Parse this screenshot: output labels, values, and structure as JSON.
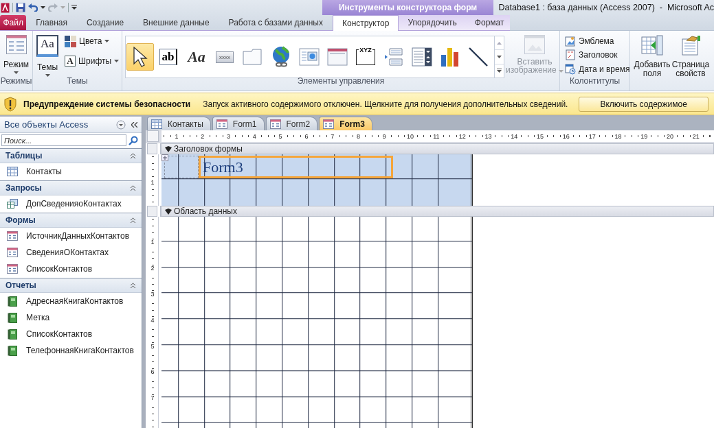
{
  "window": {
    "title": "Database1 : база данных (Access 2007)  -  Microsoft Ac"
  },
  "contextual_group": {
    "label": "Инструменты конструктора форм"
  },
  "ribbon_tabs": [
    {
      "label": "Файл",
      "kind": "file",
      "selected": false
    },
    {
      "label": "Главная",
      "kind": "main",
      "selected": false
    },
    {
      "label": "Создание",
      "kind": "main",
      "selected": false
    },
    {
      "label": "Внешние данные",
      "kind": "main",
      "selected": false
    },
    {
      "label": "Работа с базами данных",
      "kind": "main",
      "selected": false
    },
    {
      "label": "Конструктор",
      "kind": "contextual",
      "selected": true
    },
    {
      "label": "Упорядочить",
      "kind": "contextual",
      "selected": false
    },
    {
      "label": "Формат",
      "kind": "contextual",
      "selected": false
    }
  ],
  "ribbon": {
    "views": {
      "label": "Режимы",
      "button": "Режим"
    },
    "themes": {
      "label": "Темы",
      "button": "Темы",
      "button_glyph": "Aa",
      "colors": "Цвета",
      "fonts": "Шрифты",
      "fonts_glyph": "A"
    },
    "controls": {
      "label": "Элементы управления",
      "items": [
        {
          "kind": "select",
          "selected": true
        },
        {
          "kind": "textbox",
          "glyph": "ab",
          "selected": false
        },
        {
          "kind": "label",
          "glyph": "Aa",
          "selected": false
        },
        {
          "kind": "button",
          "glyph": "xxxx",
          "selected": false
        },
        {
          "kind": "tab",
          "selected": false
        },
        {
          "kind": "hyperlink",
          "selected": false
        },
        {
          "kind": "browser",
          "selected": false
        },
        {
          "kind": "navigation",
          "selected": false
        },
        {
          "kind": "optiongroup",
          "glyph": "XYZ",
          "selected": false
        },
        {
          "kind": "pagebreak",
          "selected": false
        },
        {
          "kind": "combo",
          "selected": false
        },
        {
          "kind": "chart",
          "selected": false
        },
        {
          "kind": "line",
          "selected": false
        }
      ],
      "insert_image": {
        "label": "Вставить изображение",
        "disabled": true
      }
    },
    "header_footer": {
      "label": "Колонтитулы",
      "buttons": [
        {
          "label": "Эмблема",
          "kind": "logo"
        },
        {
          "label": "Заголовок",
          "kind": "title"
        },
        {
          "label": "Дата и время",
          "kind": "datetime"
        }
      ]
    },
    "tools": {
      "buttons": [
        {
          "label": "Добавить поля",
          "kind": "add-fields"
        },
        {
          "label": "Страница свойств",
          "kind": "property-sheet"
        }
      ]
    }
  },
  "security_bar": {
    "title": "Предупреждение системы безопасности",
    "message": "Запуск активного содержимого отключен. Щелкните для получения дополнительных сведений.",
    "button": "Включить содержимое"
  },
  "navigation": {
    "title": "Все объекты Access",
    "search": {
      "placeholder": "Поиск..."
    },
    "groups": [
      {
        "label": "Таблицы",
        "expanded": true,
        "items": [
          {
            "label": "Контакты",
            "kind": "table"
          }
        ]
      },
      {
        "label": "Запросы",
        "expanded": true,
        "items": [
          {
            "label": "ДопСведенияоКонтактах",
            "kind": "query"
          }
        ]
      },
      {
        "label": "Формы",
        "expanded": true,
        "items": [
          {
            "label": "ИсточникДанныхКонтактов",
            "kind": "form"
          },
          {
            "label": "СведенияОКонтактах",
            "kind": "form"
          },
          {
            "label": "СписокКонтактов",
            "kind": "form"
          }
        ]
      },
      {
        "label": "Отчеты",
        "expanded": true,
        "items": [
          {
            "label": "АдреснаяКнигаКонтактов",
            "kind": "report"
          },
          {
            "label": "Метка",
            "kind": "report"
          },
          {
            "label": "СписокКонтактов",
            "kind": "report"
          },
          {
            "label": "ТелефоннаяКнигаКонтактов",
            "kind": "report"
          }
        ]
      }
    ]
  },
  "document_tabs": [
    {
      "label": "Контакты",
      "kind": "table",
      "selected": false
    },
    {
      "label": "Form1",
      "kind": "form",
      "selected": false
    },
    {
      "label": "Form2",
      "kind": "form",
      "selected": false
    },
    {
      "label": "Form3",
      "kind": "form",
      "selected": true
    }
  ],
  "form_designer": {
    "ruler": [
      "1",
      "2",
      "3",
      "4",
      "5",
      "6",
      "7",
      "8",
      "9",
      "10",
      "11",
      "12",
      "13",
      "14",
      "15",
      "16",
      "17",
      "18",
      "19",
      "20",
      "21"
    ],
    "sections": [
      {
        "label": "Заголовок формы",
        "kind": "header",
        "vertical_ruler": [
          "1"
        ],
        "controls": [
          {
            "text": "Form3",
            "selected": true
          }
        ]
      },
      {
        "label": "Область данных",
        "kind": "detail",
        "vertical_ruler": [
          "1",
          "2",
          "3",
          "4",
          "5",
          "6",
          "7"
        ]
      }
    ]
  }
}
